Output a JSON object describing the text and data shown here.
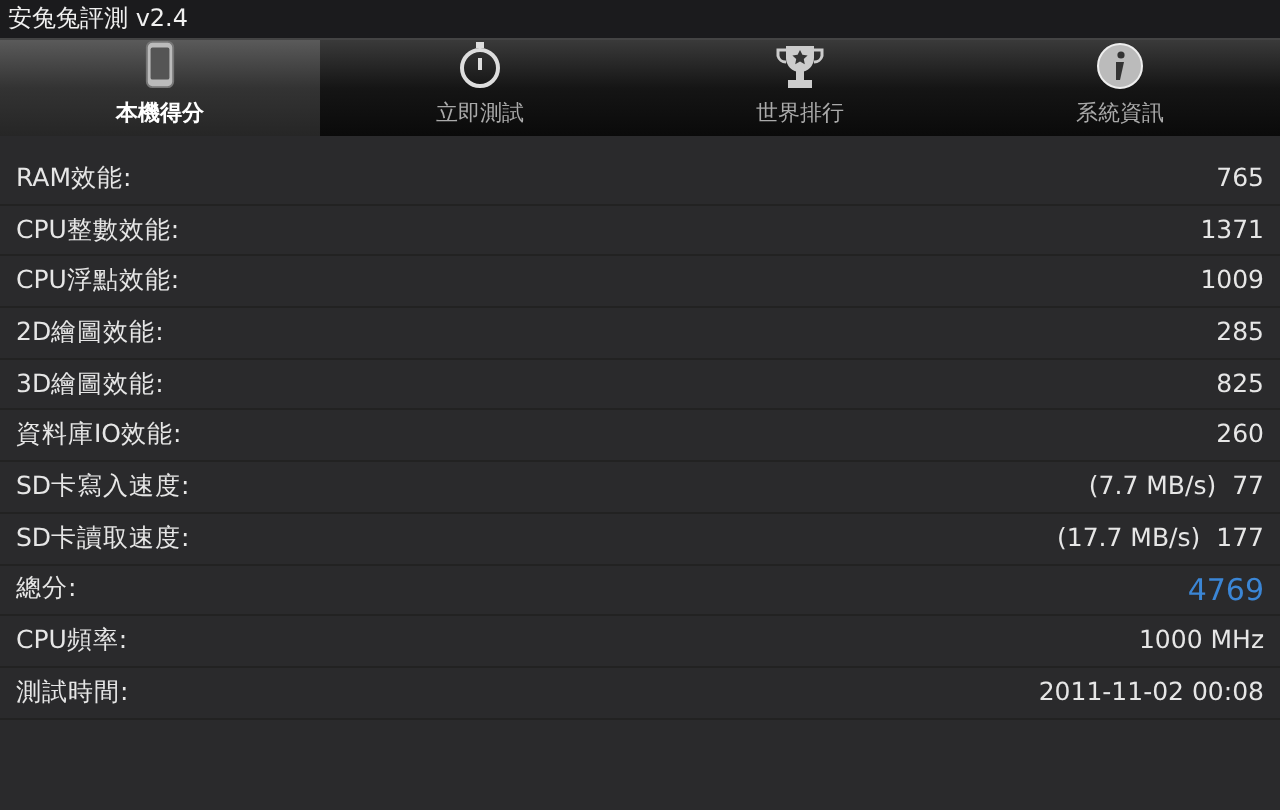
{
  "window": {
    "title": "安兔兔評測 v2.4"
  },
  "tabs": [
    {
      "label": "本機得分",
      "selected": true
    },
    {
      "label": "立即測試",
      "selected": false
    },
    {
      "label": "世界排行",
      "selected": false
    },
    {
      "label": "系統資訊",
      "selected": false
    }
  ],
  "rows": [
    {
      "label": "RAM效能:",
      "value": "765",
      "highlight": false
    },
    {
      "label": "CPU整數效能:",
      "value": "1371",
      "highlight": false
    },
    {
      "label": "CPU浮點效能:",
      "value": "1009",
      "highlight": false
    },
    {
      "label": "2D繪圖效能:",
      "value": "285",
      "highlight": false
    },
    {
      "label": "3D繪圖效能:",
      "value": "825",
      "highlight": false
    },
    {
      "label": "資料庫IO效能:",
      "value": "260",
      "highlight": false
    },
    {
      "label": "SD卡寫入速度:",
      "speed": "(7.7 MB/s)",
      "value": "77",
      "highlight": false
    },
    {
      "label": "SD卡讀取速度:",
      "speed": "(17.7 MB/s)",
      "value": "177",
      "highlight": false
    },
    {
      "label": "總分:",
      "value": "4769",
      "highlight": true
    },
    {
      "label": "CPU頻率:",
      "value": "1000 MHz",
      "highlight": false
    },
    {
      "label": "測試時間:",
      "value": "2011-11-02 00:08",
      "highlight": false
    }
  ]
}
